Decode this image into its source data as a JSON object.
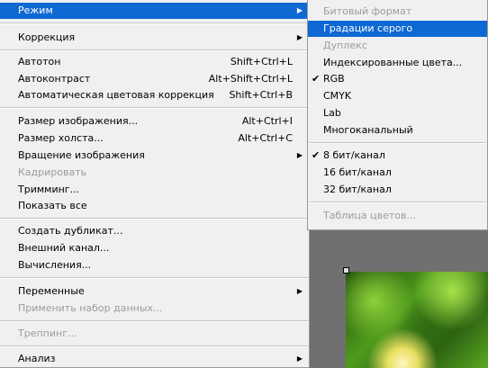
{
  "main_menu": {
    "items": [
      {
        "label": "Режим",
        "shortcut": "",
        "submenu": true,
        "disabled": false,
        "highlight": true
      },
      {
        "label": "Коррекция",
        "shortcut": "",
        "submenu": true,
        "disabled": false
      },
      {
        "label": "Автотон",
        "shortcut": "Shift+Ctrl+L",
        "submenu": false,
        "disabled": false
      },
      {
        "label": "Автоконтраст",
        "shortcut": "Alt+Shift+Ctrl+L",
        "submenu": false,
        "disabled": false
      },
      {
        "label": "Автоматическая цветовая коррекция",
        "shortcut": "Shift+Ctrl+B",
        "submenu": false,
        "disabled": false
      },
      {
        "label": "Размер изображения...",
        "shortcut": "Alt+Ctrl+I",
        "submenu": false,
        "disabled": false
      },
      {
        "label": "Размер холста...",
        "shortcut": "Alt+Ctrl+C",
        "submenu": false,
        "disabled": false
      },
      {
        "label": "Вращение изображения",
        "shortcut": "",
        "submenu": true,
        "disabled": false
      },
      {
        "label": "Кадрировать",
        "shortcut": "",
        "submenu": false,
        "disabled": true
      },
      {
        "label": "Тримминг...",
        "shortcut": "",
        "submenu": false,
        "disabled": false
      },
      {
        "label": "Показать все",
        "shortcut": "",
        "submenu": false,
        "disabled": false
      },
      {
        "label": "Создать дубликат...",
        "shortcut": "",
        "submenu": false,
        "disabled": false
      },
      {
        "label": "Внешний канал...",
        "shortcut": "",
        "submenu": false,
        "disabled": false
      },
      {
        "label": "Вычисления...",
        "shortcut": "",
        "submenu": false,
        "disabled": false
      },
      {
        "label": "Переменные",
        "shortcut": "",
        "submenu": true,
        "disabled": false
      },
      {
        "label": "Применить набор данных...",
        "shortcut": "",
        "submenu": false,
        "disabled": true
      },
      {
        "label": "Треппинг...",
        "shortcut": "",
        "submenu": false,
        "disabled": true
      },
      {
        "label": "Анализ",
        "shortcut": "",
        "submenu": true,
        "disabled": false
      }
    ]
  },
  "sub_menu": {
    "items": [
      {
        "label": "Битовый формат",
        "checked": false,
        "disabled": true
      },
      {
        "label": "Градации серого",
        "checked": false,
        "disabled": false,
        "highlight": true
      },
      {
        "label": "Дуплекс",
        "checked": false,
        "disabled": true
      },
      {
        "label": "Индексированные цвета...",
        "checked": false,
        "disabled": false
      },
      {
        "label": "RGB",
        "checked": true,
        "disabled": false
      },
      {
        "label": "CMYK",
        "checked": false,
        "disabled": false
      },
      {
        "label": "Lab",
        "checked": false,
        "disabled": false
      },
      {
        "label": "Многоканальный",
        "checked": false,
        "disabled": false
      },
      {
        "label": "8 бит/канал",
        "checked": true,
        "disabled": false
      },
      {
        "label": "16 бит/канал",
        "checked": false,
        "disabled": false
      },
      {
        "label": "32 бит/канал",
        "checked": false,
        "disabled": false
      },
      {
        "label": "Таблица цветов...",
        "checked": false,
        "disabled": true
      }
    ]
  },
  "glyphs": {
    "arrow": "▶",
    "check": "✔"
  },
  "colors": {
    "highlight": "#0f69d3",
    "menu_bg": "#f0f0f0",
    "disabled_text": "#9c9c9c",
    "workspace": "#707070"
  }
}
